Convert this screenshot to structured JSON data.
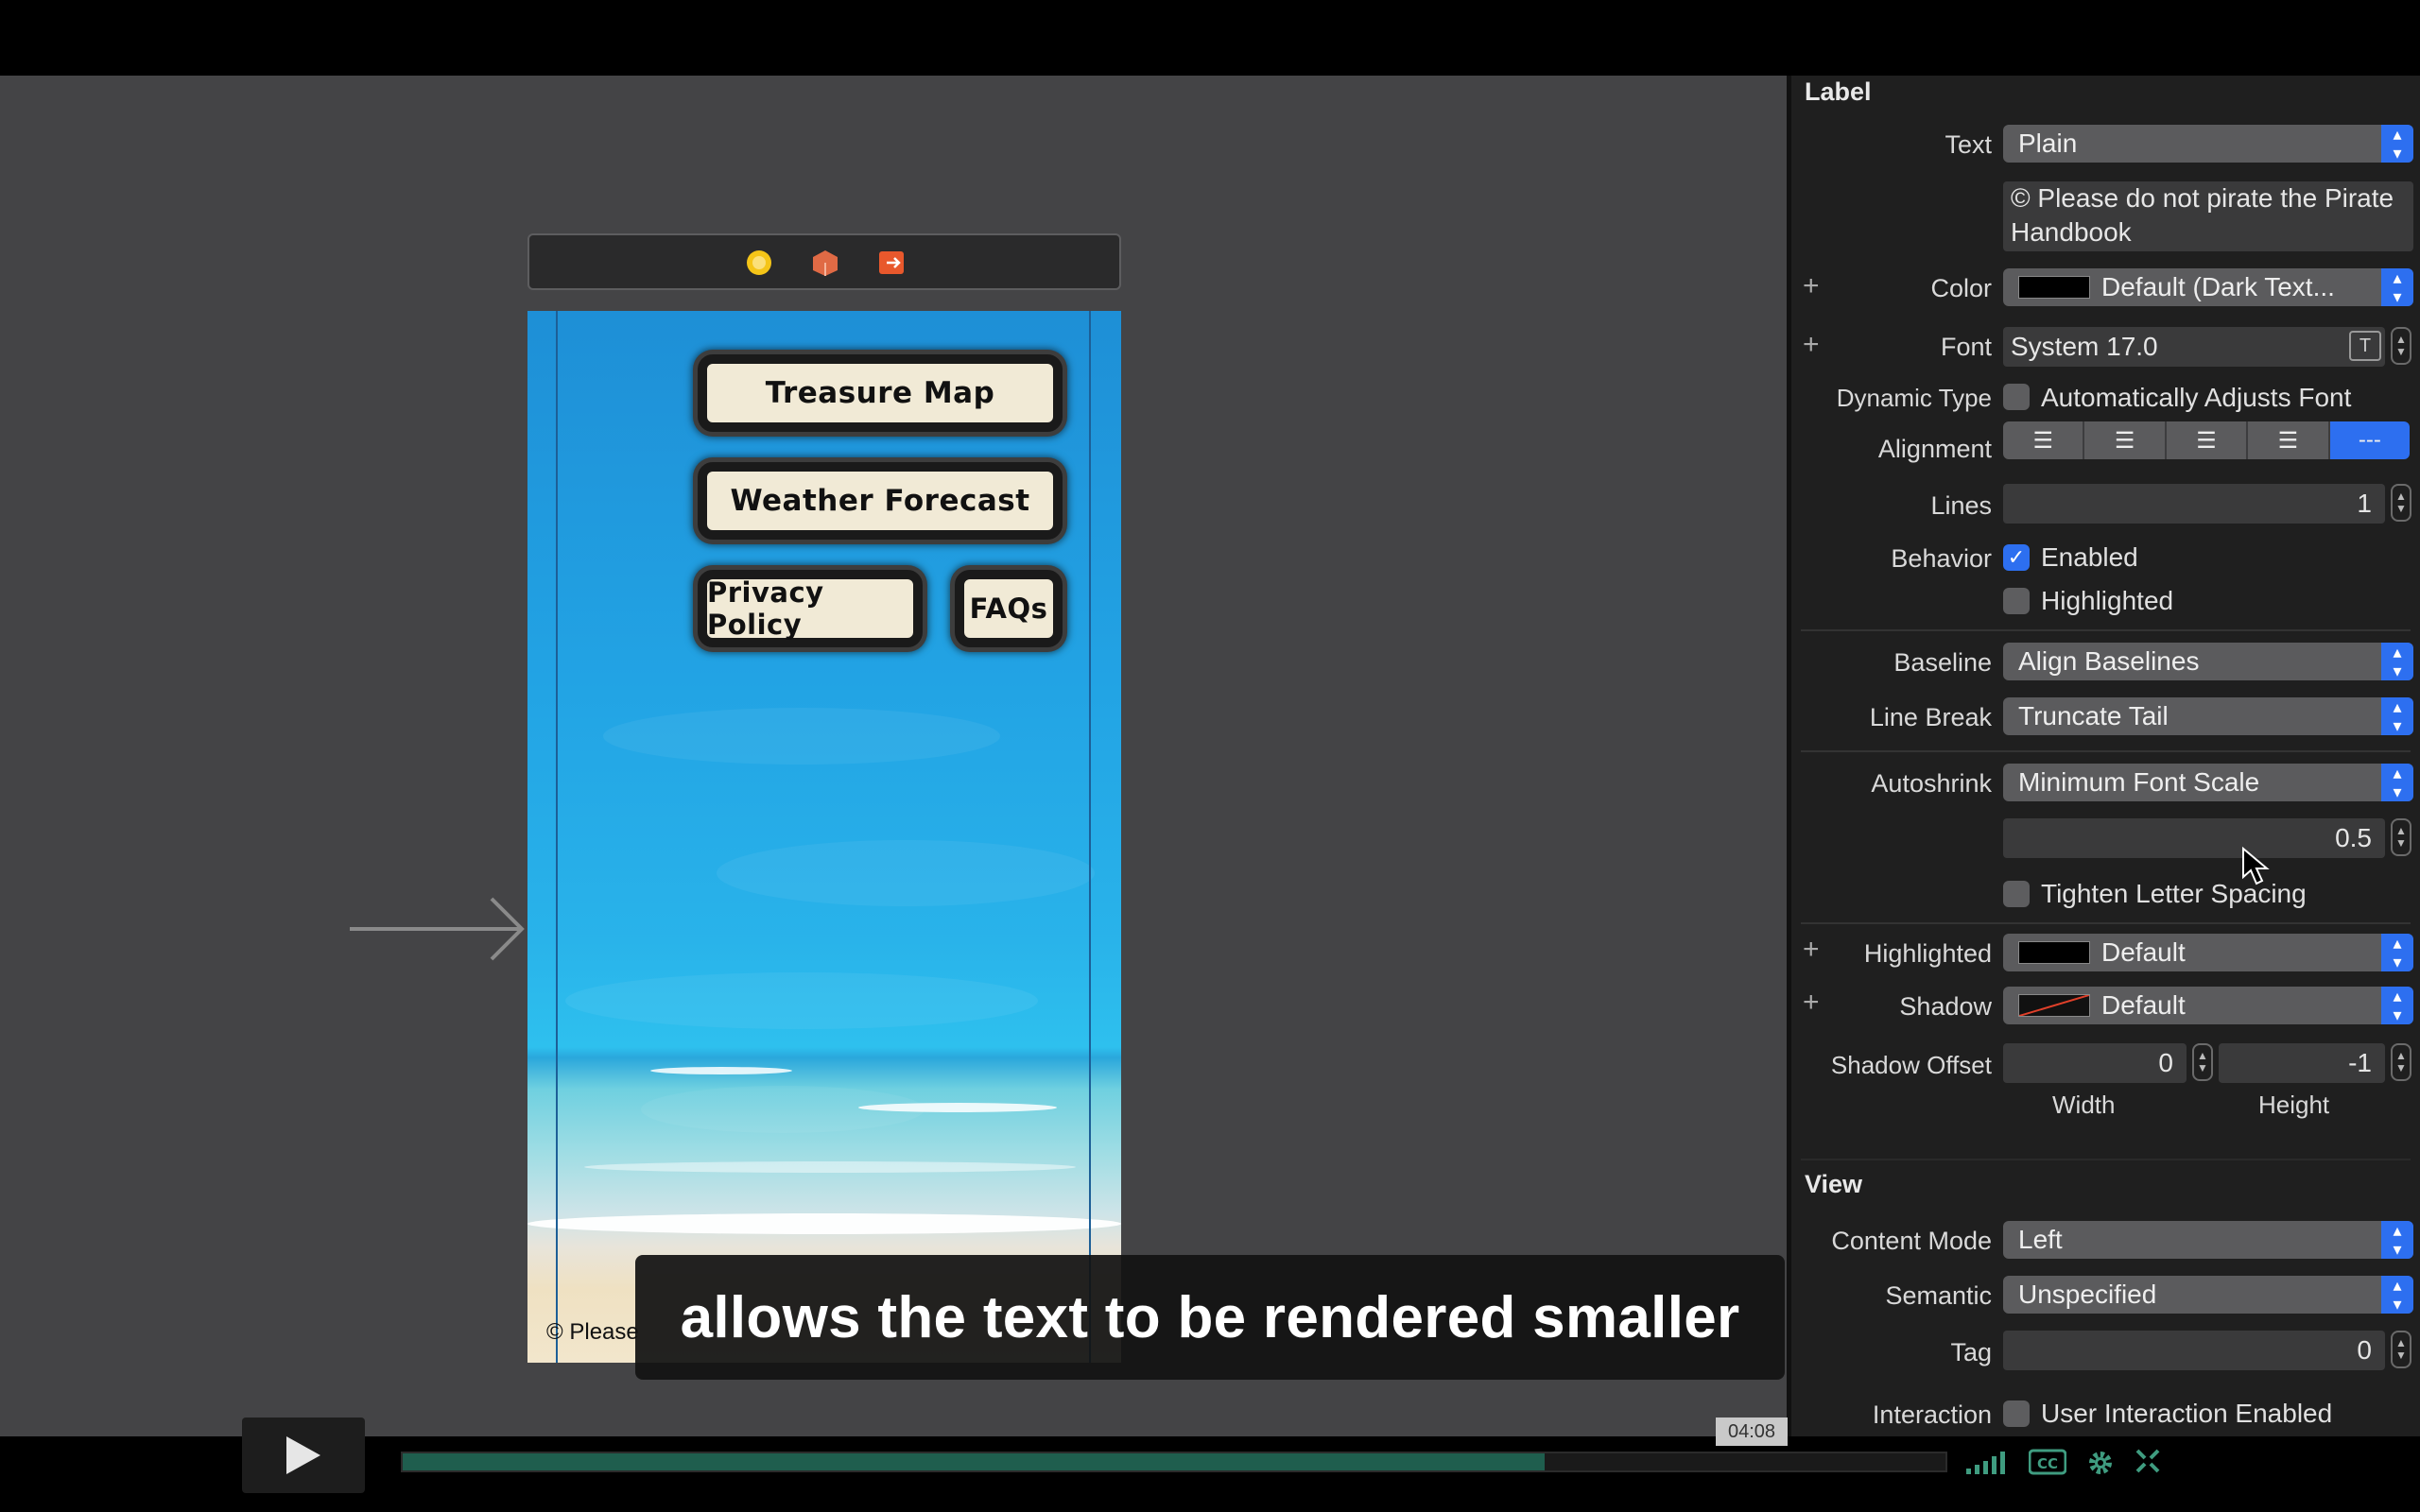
{
  "canvas": {
    "buttons": {
      "treasure_map": "Treasure Map",
      "weather_forecast": "Weather Forecast",
      "privacy_policy": "Privacy Policy",
      "faqs": "FAQs"
    },
    "footer_text": "© Please"
  },
  "caption": {
    "text": "allows the text to be rendered smaller"
  },
  "inspector": {
    "label_section": "Label",
    "text": {
      "label": "Text",
      "value": "Plain",
      "content": "© Please do not pirate the Pirate Handbook"
    },
    "color": {
      "label": "Color",
      "value": "Default (Dark Text..."
    },
    "font": {
      "label": "Font",
      "value": "System 17.0"
    },
    "dynamic_type": {
      "label": "Dynamic Type",
      "option": "Automatically Adjusts Font"
    },
    "alignment": {
      "label": "Alignment",
      "selected": "---"
    },
    "lines": {
      "label": "Lines",
      "value": "1"
    },
    "behavior": {
      "label": "Behavior",
      "enabled": "Enabled",
      "highlighted": "Highlighted"
    },
    "baseline": {
      "label": "Baseline",
      "value": "Align Baselines"
    },
    "line_break": {
      "label": "Line Break",
      "value": "Truncate Tail"
    },
    "autoshrink": {
      "label": "Autoshrink",
      "value": "Minimum Font Scale",
      "scale": "0.5",
      "tighten": "Tighten Letter Spacing"
    },
    "highlighted": {
      "label": "Highlighted",
      "value": "Default"
    },
    "shadow": {
      "label": "Shadow",
      "value": "Default"
    },
    "shadow_offset": {
      "label": "Shadow Offset",
      "width_value": "0",
      "height_value": "-1",
      "width_label": "Width",
      "height_label": "Height"
    },
    "view_section": "View",
    "content_mode": {
      "label": "Content Mode",
      "value": "Left"
    },
    "semantic": {
      "label": "Semantic",
      "value": "Unspecified"
    },
    "tag": {
      "label": "Tag",
      "value": "0"
    },
    "interaction": {
      "label": "Interaction",
      "option": "User Interaction Enabled"
    }
  },
  "player": {
    "time": "04:08",
    "progress": 0.74
  },
  "colors": {
    "accent": "#2d6ff0",
    "progress": "#1f5e4e"
  }
}
